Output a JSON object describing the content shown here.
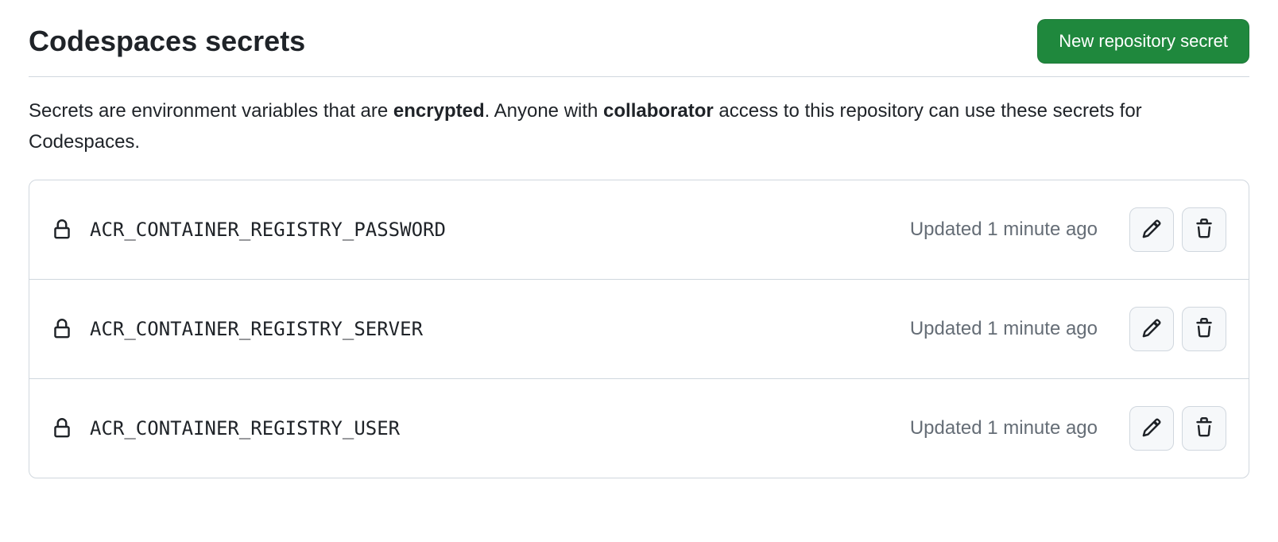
{
  "header": {
    "title": "Codespaces secrets",
    "new_button": "New repository secret"
  },
  "description": {
    "prefix": "Secrets are environment variables that are ",
    "encrypted": "encrypted",
    "mid": ". Anyone with ",
    "collaborator": "collaborator",
    "suffix": " access to this repository can use these secrets for Codespaces."
  },
  "secrets": [
    {
      "name": "ACR_CONTAINER_REGISTRY_PASSWORD",
      "updated": "Updated 1 minute ago"
    },
    {
      "name": "ACR_CONTAINER_REGISTRY_SERVER",
      "updated": "Updated 1 minute ago"
    },
    {
      "name": "ACR_CONTAINER_REGISTRY_USER",
      "updated": "Updated 1 minute ago"
    }
  ]
}
